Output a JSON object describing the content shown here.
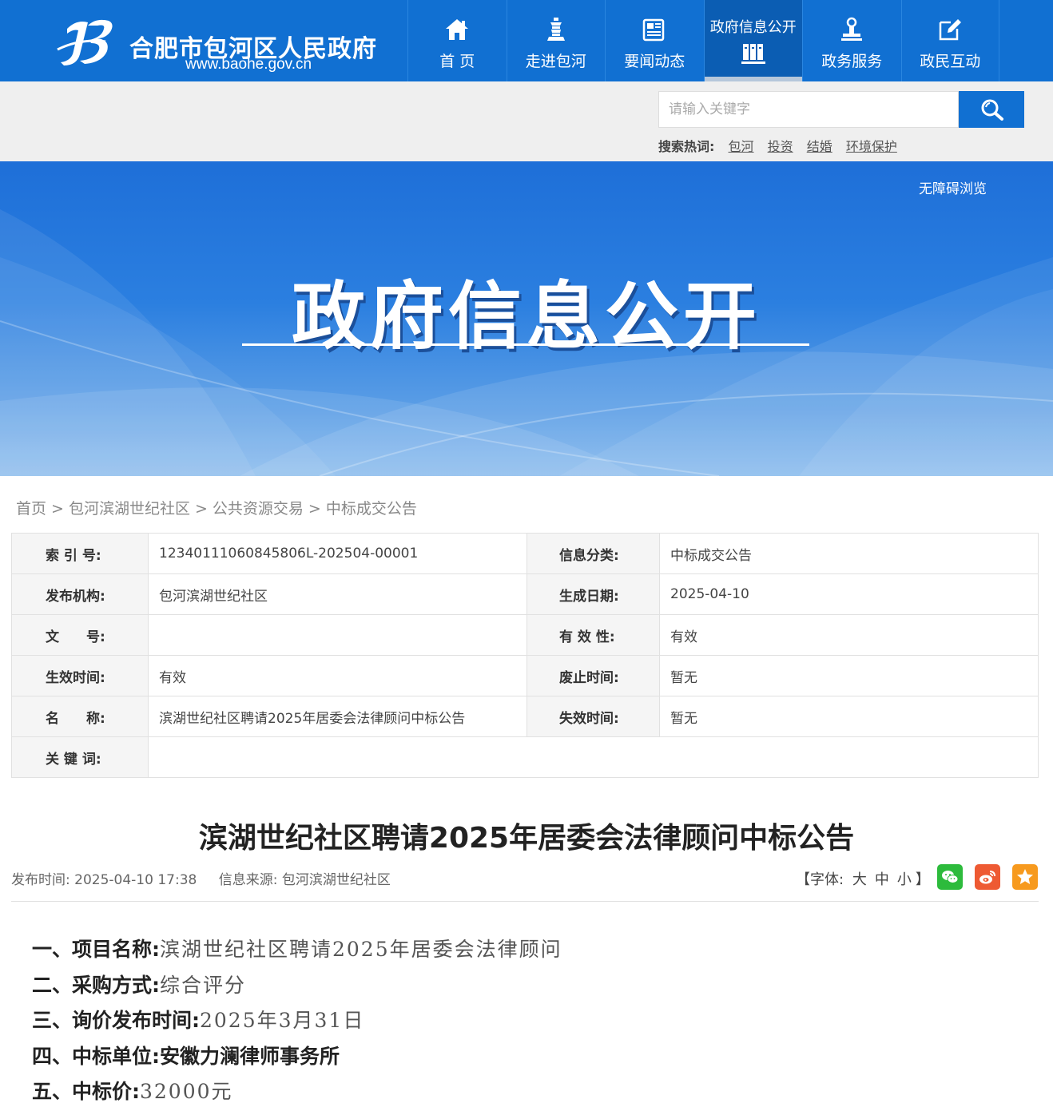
{
  "header": {
    "site_name": "合肥市包河区人民政府",
    "site_url": "www.baohe.gov.cn",
    "nav": [
      {
        "label": "首 页",
        "icon": "home-icon"
      },
      {
        "label": "走进包河",
        "icon": "tower-icon"
      },
      {
        "label": "要闻动态",
        "icon": "newspaper-icon"
      },
      {
        "label": "政府信息公开",
        "icon": "books-icon",
        "active": true
      },
      {
        "label": "政务服务",
        "icon": "stamp-icon"
      },
      {
        "label": "政民互动",
        "icon": "edit-icon"
      }
    ]
  },
  "search": {
    "placeholder": "请输入关键字",
    "hot_label": "搜索热词:",
    "hot_words": [
      "包河",
      "投资",
      "结婚",
      "环境保护"
    ]
  },
  "banner": {
    "accessibility": "无障碍浏览",
    "title": "政府信息公开"
  },
  "breadcrumb": [
    "首页",
    "包河滨湖世纪社区",
    "公共资源交易",
    "中标成交公告"
  ],
  "breadcrumb_sep": ">",
  "info": {
    "index_no_label": "索 引 号:",
    "index_no": "12340111060845806L-202504-00001",
    "category_label": "信息分类:",
    "category": "中标成交公告",
    "publisher_label": "发布机构:",
    "publisher": "包河滨湖世纪社区",
    "created_label": "生成日期:",
    "created": "2025-04-10",
    "doc_no_label": "文　　号:",
    "doc_no": "",
    "validity_label": "有 效 性:",
    "validity": "有效",
    "effective_label": "生效时间:",
    "effective": "有效",
    "repeal_label": "废止时间:",
    "repeal": "暂无",
    "name_label": "名　　称:",
    "name": "滨湖世纪社区聘请2025年居委会法律顾问中标公告",
    "expire_label": "失效时间:",
    "expire": "暂无",
    "keywords_label": "关 键 词:",
    "keywords": ""
  },
  "article": {
    "title": "滨湖世纪社区聘请2025年居委会法律顾问中标公告",
    "publish_label": "发布时间:",
    "publish_time": "2025-04-10 17:38",
    "source_label": "信息来源:",
    "source": "包河滨湖世纪社区",
    "font_open": "【字体:",
    "font_large": "大",
    "font_medium": "中",
    "font_small": "小",
    "font_close": "】",
    "lines": [
      {
        "key": "一、项目名称:",
        "value": "滨湖世纪社区聘请2025年居委会法律顾问"
      },
      {
        "key": "二、采购方式:",
        "value": "综合评分"
      },
      {
        "key": "三、询价发布时间:",
        "value": "2025年3月31日"
      },
      {
        "key": "四、中标单位:",
        "value": "安徽力澜律师事务所",
        "bold": true
      },
      {
        "key": "五、中标价:",
        "value": "32000元"
      }
    ]
  },
  "colors": {
    "primary": "#1170d2",
    "nav_active": "#0b5db3",
    "wechat": "#2dbb3c",
    "weibo": "#ee5a33",
    "favorite": "#f79a1e"
  }
}
